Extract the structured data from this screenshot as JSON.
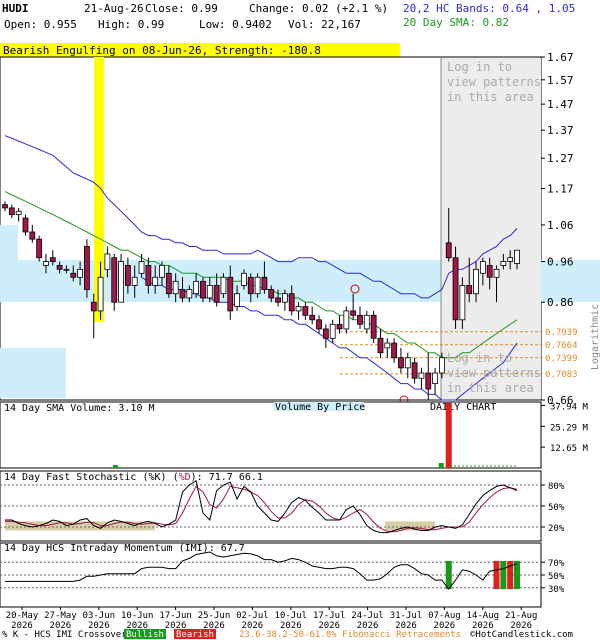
{
  "header": {
    "symbol": "HUDI",
    "date": "21-Aug-26",
    "close": "Close: 0.99",
    "change": "Change: 0.02 (+2.1 %)",
    "open": "Open: 0.955",
    "high": "High: 0.99",
    "low": "Low: 0.9402",
    "volume": "Vol: 22,167",
    "bands": "20,2 HC Bands: 0.64 , 1.05",
    "sma": "20 Day SMA: 0.82"
  },
  "main": {
    "pattern_banner": "Bearish Engulfing on 08-Jun-26, Strength: -180.8",
    "login_text_1": [
      "Log in to",
      "view patterns",
      "in this area"
    ],
    "login_text_2": [
      "Log in to",
      "view patterns",
      "in this area"
    ],
    "y_axis_label": "Logarithmic",
    "volume_by_price_label": "Volume By Price",
    "daily_chart_label": "DAILY CHART"
  },
  "footer": {
    "legend_label": "% K - HCS IMI Crossover:",
    "bullish": "Bullish",
    "bearish": "Bearish",
    "fib": "23.6-38.2-50-61.8% Fibonacci Retracements",
    "copyright": "©HotCandlestick.com"
  },
  "chart_data": [
    {
      "type": "candlestick",
      "title": "HUDI",
      "scale": "log",
      "ylim": [
        0.66,
        1.67
      ],
      "ticks": [
        "1.67",
        "1.57",
        "1.47",
        "1.37",
        "1.27",
        "1.17",
        "1.06",
        "0.96",
        "0.86",
        "0.66"
      ],
      "fib_levels": [
        "0.7939",
        "0.7664",
        "0.7399",
        "0.7083"
      ],
      "x_labels": [
        "20-May 2026",
        "27-May 2026",
        "03-Jun 2026",
        "10-Jun 2026",
        "17-Jun 2026",
        "25-Jun 2026",
        "02-Jul 2026",
        "10-Jul 2026",
        "17-Jul 2026",
        "24-Jul 2026",
        "31-Jul 2026",
        "07-Aug 2026",
        "14-Aug 2026",
        "21-Aug 2026"
      ],
      "candles": [
        [
          1.12,
          1.13,
          1.1,
          1.11
        ],
        [
          1.11,
          1.12,
          1.08,
          1.09
        ],
        [
          1.09,
          1.11,
          1.07,
          1.1
        ],
        [
          1.08,
          1.09,
          1.03,
          1.04
        ],
        [
          1.04,
          1.06,
          1.01,
          1.02
        ],
        [
          1.02,
          1.03,
          0.96,
          0.97
        ],
        [
          0.95,
          0.98,
          0.93,
          0.96
        ],
        [
          0.97,
          0.99,
          0.95,
          0.96
        ],
        [
          0.95,
          0.96,
          0.93,
          0.94
        ],
        [
          0.94,
          0.95,
          0.93,
          0.94
        ],
        [
          0.93,
          0.95,
          0.91,
          0.92
        ],
        [
          0.92,
          0.96,
          0.9,
          0.94
        ],
        [
          1.0,
          1.02,
          0.87,
          0.89
        ],
        [
          0.86,
          0.88,
          0.78,
          0.84
        ],
        [
          0.84,
          0.96,
          0.82,
          0.92
        ],
        [
          0.94,
          1.0,
          0.92,
          0.98
        ],
        [
          0.97,
          0.98,
          0.84,
          0.86
        ],
        [
          0.86,
          0.98,
          0.86,
          0.96
        ],
        [
          0.95,
          0.97,
          0.88,
          0.9
        ],
        [
          0.9,
          0.95,
          0.87,
          0.92
        ],
        [
          0.93,
          0.98,
          0.92,
          0.96
        ],
        [
          0.95,
          0.97,
          0.88,
          0.9
        ],
        [
          0.9,
          0.95,
          0.88,
          0.92
        ],
        [
          0.92,
          0.96,
          0.9,
          0.95
        ],
        [
          0.93,
          0.95,
          0.87,
          0.88
        ],
        [
          0.88,
          0.93,
          0.86,
          0.91
        ],
        [
          0.89,
          0.92,
          0.86,
          0.87
        ],
        [
          0.87,
          0.9,
          0.86,
          0.89
        ],
        [
          0.88,
          0.93,
          0.87,
          0.91
        ],
        [
          0.91,
          0.92,
          0.86,
          0.87
        ],
        [
          0.87,
          0.92,
          0.86,
          0.9
        ],
        [
          0.9,
          0.93,
          0.85,
          0.86
        ],
        [
          0.88,
          0.93,
          0.87,
          0.92
        ],
        [
          0.92,
          0.95,
          0.82,
          0.84
        ],
        [
          0.85,
          0.9,
          0.84,
          0.88
        ],
        [
          0.9,
          0.94,
          0.89,
          0.93
        ],
        [
          0.92,
          0.93,
          0.86,
          0.88
        ],
        [
          0.88,
          0.93,
          0.87,
          0.92
        ],
        [
          0.92,
          0.96,
          0.88,
          0.89
        ],
        [
          0.89,
          0.9,
          0.86,
          0.87
        ],
        [
          0.87,
          0.89,
          0.85,
          0.86
        ],
        [
          0.86,
          0.89,
          0.84,
          0.88
        ],
        [
          0.88,
          0.9,
          0.83,
          0.84
        ],
        [
          0.84,
          0.86,
          0.82,
          0.85
        ],
        [
          0.85,
          0.86,
          0.82,
          0.83
        ],
        [
          0.83,
          0.85,
          0.81,
          0.82
        ],
        [
          0.82,
          0.83,
          0.79,
          0.8
        ],
        [
          0.8,
          0.81,
          0.76,
          0.78
        ],
        [
          0.78,
          0.82,
          0.77,
          0.81
        ],
        [
          0.81,
          0.83,
          0.79,
          0.8
        ],
        [
          0.8,
          0.85,
          0.79,
          0.84
        ],
        [
          0.84,
          0.88,
          0.82,
          0.83
        ],
        [
          0.83,
          0.85,
          0.8,
          0.81
        ],
        [
          0.8,
          0.84,
          0.79,
          0.83
        ],
        [
          0.83,
          0.84,
          0.77,
          0.78
        ],
        [
          0.78,
          0.8,
          0.74,
          0.75
        ],
        [
          0.76,
          0.78,
          0.74,
          0.77
        ],
        [
          0.77,
          0.78,
          0.73,
          0.74
        ],
        [
          0.74,
          0.76,
          0.71,
          0.72
        ],
        [
          0.72,
          0.75,
          0.7,
          0.74
        ],
        [
          0.73,
          0.74,
          0.69,
          0.7
        ],
        [
          0.7,
          0.72,
          0.68,
          0.71
        ],
        [
          0.71,
          0.75,
          0.66,
          0.68
        ],
        [
          0.69,
          0.72,
          0.67,
          0.71
        ],
        [
          0.71,
          0.75,
          0.7,
          0.74
        ],
        [
          1.01,
          1.11,
          0.96,
          0.97
        ],
        [
          0.97,
          1.0,
          0.8,
          0.82
        ],
        [
          0.82,
          0.92,
          0.8,
          0.9
        ],
        [
          0.9,
          0.97,
          0.86,
          0.88
        ],
        [
          0.88,
          0.96,
          0.86,
          0.94
        ],
        [
          0.93,
          0.97,
          0.9,
          0.96
        ],
        [
          0.95,
          0.97,
          0.89,
          0.92
        ],
        [
          0.92,
          0.95,
          0.86,
          0.94
        ],
        [
          0.95,
          0.98,
          0.94,
          0.96
        ],
        [
          0.96,
          0.99,
          0.94,
          0.97
        ],
        [
          0.955,
          0.99,
          0.9402,
          0.99
        ]
      ],
      "upper_band": [
        1.35,
        1.34,
        1.33,
        1.32,
        1.31,
        1.3,
        1.29,
        1.28,
        1.26,
        1.24,
        1.22,
        1.21,
        1.2,
        1.19,
        1.17,
        1.14,
        1.12,
        1.1,
        1.08,
        1.06,
        1.04,
        1.03,
        1.03,
        1.02,
        1.02,
        1.01,
        1.01,
        1.0,
        1.0,
        0.99,
        0.99,
        0.99,
        0.98,
        0.98,
        0.98,
        0.98,
        0.98,
        0.99,
        0.98,
        0.97,
        0.96,
        0.96,
        0.96,
        0.97,
        0.97,
        0.97,
        0.96,
        0.96,
        0.95,
        0.94,
        0.93,
        0.93,
        0.93,
        0.92,
        0.91,
        0.91,
        0.9,
        0.89,
        0.88,
        0.88,
        0.88,
        0.87,
        0.87,
        0.88,
        0.89,
        0.93,
        0.94,
        0.94,
        0.95,
        0.96,
        0.98,
        0.99,
        1.0,
        1.02,
        1.03,
        1.05
      ],
      "sma20": [
        1.16,
        1.15,
        1.14,
        1.13,
        1.12,
        1.11,
        1.1,
        1.09,
        1.08,
        1.07,
        1.06,
        1.05,
        1.04,
        1.03,
        1.02,
        1.01,
        1.0,
        0.99,
        0.99,
        0.98,
        0.97,
        0.96,
        0.96,
        0.95,
        0.95,
        0.94,
        0.93,
        0.93,
        0.93,
        0.92,
        0.92,
        0.92,
        0.92,
        0.91,
        0.91,
        0.91,
        0.9,
        0.9,
        0.89,
        0.89,
        0.88,
        0.88,
        0.87,
        0.87,
        0.86,
        0.86,
        0.85,
        0.84,
        0.84,
        0.83,
        0.83,
        0.82,
        0.82,
        0.81,
        0.81,
        0.8,
        0.79,
        0.79,
        0.78,
        0.77,
        0.77,
        0.76,
        0.75,
        0.75,
        0.74,
        0.74,
        0.74,
        0.75,
        0.75,
        0.76,
        0.77,
        0.78,
        0.79,
        0.8,
        0.81,
        0.82
      ],
      "lower_band": [
        null,
        null,
        null,
        null,
        null,
        null,
        null,
        null,
        null,
        null,
        null,
        null,
        null,
        null,
        null,
        null,
        null,
        null,
        null,
        null,
        0.92,
        0.91,
        0.9,
        0.9,
        0.89,
        0.89,
        0.89,
        0.88,
        0.88,
        0.87,
        0.87,
        0.86,
        0.86,
        0.86,
        0.85,
        0.85,
        0.84,
        0.84,
        0.83,
        0.83,
        0.83,
        0.82,
        0.82,
        0.81,
        0.81,
        0.8,
        0.79,
        0.78,
        0.77,
        0.76,
        0.76,
        0.75,
        0.74,
        0.74,
        0.73,
        0.72,
        0.71,
        0.7,
        0.69,
        0.69,
        0.68,
        0.68,
        0.67,
        0.67,
        0.66,
        0.66,
        0.66,
        0.67,
        0.68,
        0.69,
        0.7,
        0.71,
        0.72,
        0.73,
        0.75,
        0.77
      ]
    },
    {
      "type": "bar",
      "title": "14 Day SMA Volume: 3.10 M",
      "ticks": [
        "37.94 M",
        "25.29 M",
        "12.65 M"
      ],
      "ylim": [
        0,
        40
      ],
      "spike_index": 65,
      "spike_value": 39.5
    },
    {
      "type": "line",
      "title": "14 Day Fast Stochastic (%K) (%D): 71.7 66.1",
      "title_prefix": "14 Day Fast Stochastic (",
      "k_label": "%K",
      "d_label": "%D",
      "title_values": "): 71.7  66.1",
      "ticks": [
        "80%",
        "50%",
        "20%"
      ],
      "ylim": [
        0,
        100
      ],
      "k": [
        30,
        30,
        25,
        22,
        20,
        22,
        25,
        30,
        28,
        22,
        24,
        30,
        32,
        22,
        18,
        26,
        30,
        28,
        25,
        22,
        26,
        28,
        25,
        20,
        24,
        30,
        70,
        80,
        86,
        40,
        30,
        72,
        80,
        84,
        60,
        78,
        70,
        50,
        40,
        30,
        28,
        40,
        55,
        62,
        58,
        48,
        40,
        30,
        30,
        30,
        45,
        50,
        38,
        22,
        15,
        12,
        12,
        15,
        18,
        20,
        17,
        15,
        15,
        20,
        22,
        20,
        18,
        23,
        38,
        53,
        65,
        72,
        78,
        80,
        76,
        72
      ],
      "d": [
        28,
        28,
        27,
        26,
        24,
        22,
        22,
        24,
        26,
        26,
        24,
        25,
        27,
        26,
        22,
        22,
        25,
        27,
        27,
        25,
        24,
        25,
        26,
        24,
        23,
        25,
        40,
        60,
        78,
        70,
        52,
        47,
        60,
        78,
        76,
        74,
        70,
        65,
        55,
        42,
        33,
        33,
        40,
        52,
        59,
        57,
        50,
        40,
        33,
        30,
        34,
        40,
        45,
        38,
        27,
        18,
        14,
        13,
        15,
        18,
        19,
        18,
        16,
        16,
        18,
        20,
        20,
        20,
        27,
        40,
        52,
        62,
        70,
        75,
        76,
        74
      ]
    },
    {
      "type": "line",
      "title": "14 Day HCS Intraday Momentum (IMI): 67.7",
      "ticks": [
        "70%",
        "50%",
        "30%"
      ],
      "ylim": [
        0,
        100
      ],
      "imi": [
        40,
        40,
        40,
        40,
        40,
        40,
        40,
        40,
        40,
        40,
        40,
        42,
        48,
        48,
        50,
        52,
        52,
        52,
        52,
        52,
        60,
        62,
        62,
        62,
        60,
        60,
        72,
        76,
        82,
        84,
        86,
        80,
        78,
        80,
        82,
        84,
        83,
        80,
        74,
        74,
        70,
        72,
        76,
        74,
        70,
        64,
        62,
        60,
        60,
        62,
        62,
        60,
        52,
        42,
        42,
        44,
        52,
        62,
        66,
        66,
        60,
        52,
        50,
        42,
        42,
        28,
        42,
        58,
        56,
        50,
        42,
        56,
        58,
        60,
        64,
        67.7
      ],
      "crossovers": [
        {
          "index": 65,
          "type": "bullish"
        },
        {
          "index": 72,
          "type": "bearish"
        },
        {
          "index": 73,
          "type": "bullish"
        },
        {
          "index": 74,
          "type": "bearish"
        },
        {
          "index": 75,
          "type": "bullish"
        }
      ]
    }
  ]
}
